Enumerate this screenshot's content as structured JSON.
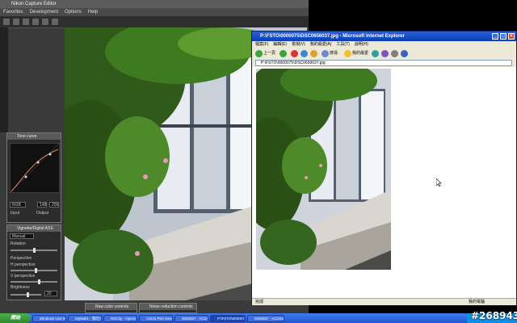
{
  "editor": {
    "title": "Nikon Capture Editor",
    "menu": [
      "Favorites",
      "Development",
      "Options",
      "Help"
    ],
    "tone_curve_panel": {
      "title": "Tone curve",
      "channel": "RGB",
      "input_value": "148",
      "output_value": "206",
      "labels": [
        "Input",
        "Output"
      ]
    },
    "vignette_panel": {
      "title": "Vignette/Digital ASS",
      "mode": "Manual",
      "rotation_label": "Rotation",
      "perspective_label": "Perspective",
      "h_perspective_label": "H perspective",
      "v_perspective_label": "V perspective",
      "brightness_label": "Brightness",
      "value": "20"
    },
    "bottom_panels": [
      "Raw color controls",
      "Noise reduction controls"
    ]
  },
  "ie": {
    "title": "P:\\FSTO\\0000075\\DSC0656037.jpg - Microsoft Internet Explorer",
    "menu": [
      "檔案(F)",
      "編輯(E)",
      "檢視(V)",
      "我的最愛(A)",
      "工具(T)",
      "說明(H)"
    ],
    "back_label": "上一頁",
    "search_label": "搜尋",
    "favorites_label": "我的最愛",
    "address": "P:\\FSTO\\0000075\\DSC0656037.jpg",
    "status": "完成",
    "status_zone": "我的電腦"
  },
  "taskbar": {
    "start_label": "開始",
    "tasks": [
      "Windows Live Messenger",
      "MyMail1 - 我的文件",
      "RDCity - Opera PC(Ab)",
      "ASUS P5X Developer",
      "0000007 - ACDSee Pro 3",
      "P:\\FSTO\\0000075DSC",
      "0000007 - ACDSee 10"
    ],
    "watermark": "#268943"
  }
}
